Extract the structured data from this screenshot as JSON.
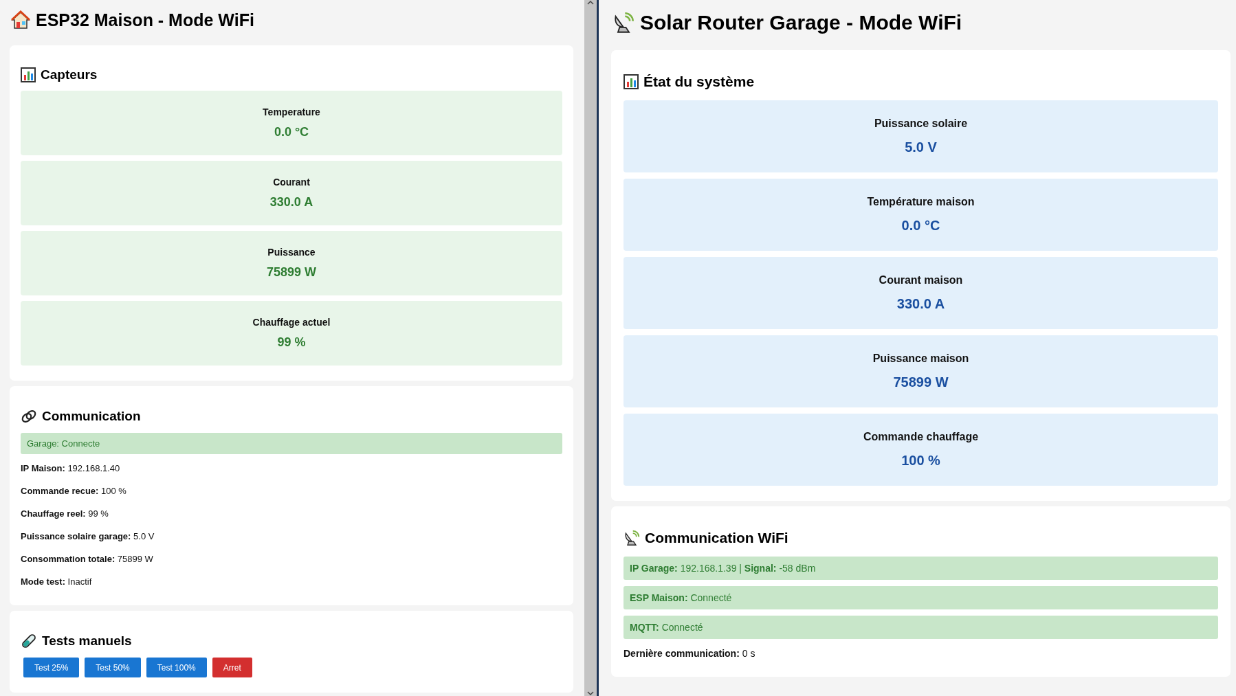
{
  "left_window": {
    "title": "ESP32 Maison - Mode WiFi",
    "sensors": {
      "heading": "Capteurs",
      "items": [
        {
          "label": "Temperature",
          "value": "0.0 °C"
        },
        {
          "label": "Courant",
          "value": "330.0 A"
        },
        {
          "label": "Puissance",
          "value": "75899 W"
        },
        {
          "label": "Chauffage actuel",
          "value": "99 %"
        }
      ]
    },
    "communication": {
      "heading": "Communication",
      "status": "Garage: Connecte",
      "lines": [
        "**IP Maison:** 192.168.1.40",
        "**Commande recue:** 100 %",
        "**Chauffage reel:** 99 %",
        "**Puissance solaire garage:** 5.0 V",
        "**Consommation totale:** 75899 W",
        "**Mode test:** Inactif"
      ]
    },
    "tests": {
      "heading": "Tests manuels",
      "buttons": [
        {
          "label": "Test 25%",
          "kind": "primary"
        },
        {
          "label": "Test 50%",
          "kind": "primary"
        },
        {
          "label": "Test 100%",
          "kind": "primary"
        },
        {
          "label": "Arret",
          "kind": "danger"
        }
      ]
    }
  },
  "right_window": {
    "title": "Solar Router Garage - Mode WiFi",
    "system": {
      "heading": "État du système",
      "items": [
        {
          "label": "Puissance solaire",
          "value": "5.0 V"
        },
        {
          "label": "Température maison",
          "value": "0.0 °C"
        },
        {
          "label": "Courant maison",
          "value": "330.0 A"
        },
        {
          "label": "Puissance maison",
          "value": "75899 W"
        },
        {
          "label": "Commande chauffage",
          "value": "100 %"
        }
      ]
    },
    "communication": {
      "heading": "Communication WiFi",
      "status_lines": [
        "**IP Garage:** 192.168.1.39 | **Signal:** -58 dBm",
        "**ESP Maison:** Connecté",
        "**MQTT:** Connecté"
      ],
      "last": "**Dernière communication:** 0 s"
    }
  }
}
